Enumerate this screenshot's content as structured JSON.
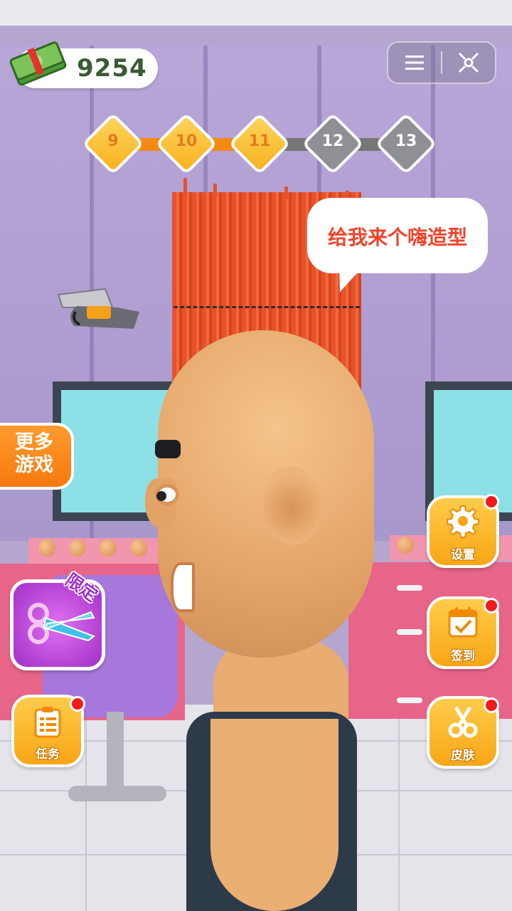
{
  "hud": {
    "money": "9254",
    "money_icon": "cash-stack-icon",
    "menu_icon": "menu-icon",
    "close_icon": "target-close-icon"
  },
  "levels": [
    {
      "label": "9",
      "state": "done"
    },
    {
      "label": "10",
      "state": "done"
    },
    {
      "label": "11",
      "state": "done"
    },
    {
      "label": "12",
      "state": "todo"
    },
    {
      "label": "13",
      "state": "todo"
    }
  ],
  "speech": {
    "text": "给我来个嗨造型"
  },
  "left": {
    "more_games": "更多\n游戏",
    "limited_tag": "限定",
    "limited_icon": "scissors-icon",
    "tasks_label": "任务",
    "tasks_icon": "clipboard-icon"
  },
  "right": {
    "settings_label": "设置",
    "settings_icon": "gear-icon",
    "checkin_label": "签到",
    "checkin_icon": "calendar-check-icon",
    "skins_label": "皮肤",
    "skins_icon": "scissors-icon"
  },
  "colors": {
    "accent_orange": "#f58a12",
    "button_yellow": "#f8a615",
    "bubble_text": "#f0442a",
    "notify_red": "#f21a1a",
    "limited_purple": "#a02fc8"
  }
}
